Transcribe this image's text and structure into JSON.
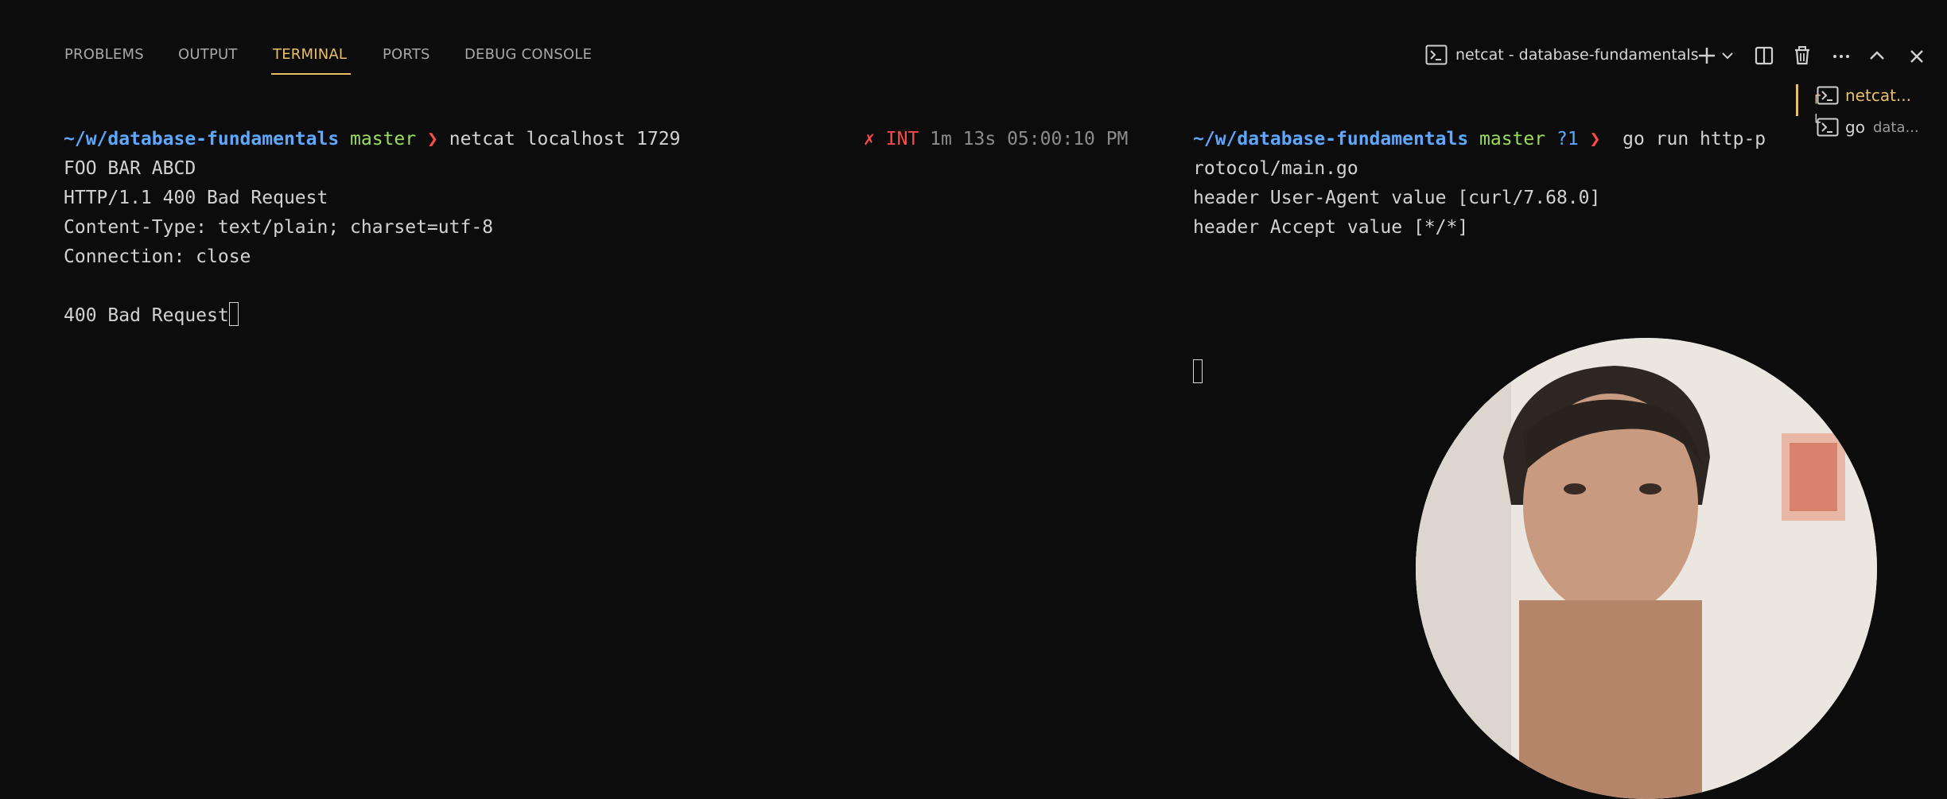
{
  "panel_tabs": [
    {
      "label": "PROBLEMS"
    },
    {
      "label": "OUTPUT"
    },
    {
      "label": "TERMINAL"
    },
    {
      "label": "PORTS"
    },
    {
      "label": "DEBUG CONSOLE"
    }
  ],
  "active_tab": "TERMINAL",
  "terminal_title": "netcat - database-fundamentals",
  "terminal_list": [
    {
      "label": "netcat...",
      "icon": "terminal-icon"
    },
    {
      "label": "go",
      "detail": "data...",
      "icon": "terminal-icon"
    }
  ],
  "left_pane": {
    "prompt": {
      "path_prefix": "~/w/",
      "path_dir": "database-fundamentals",
      "branch": "master",
      "arrow": "❯",
      "command": "netcat localhost 1729"
    },
    "status": {
      "mark": "✗",
      "signal": "INT",
      "duration": "1m 13s",
      "time": "05:00:10 PM"
    },
    "output": [
      "FOO BAR ABCD",
      "HTTP/1.1 400 Bad Request",
      "Content-Type: text/plain; charset=utf-8",
      "Connection: close",
      "",
      "400 Bad Request"
    ]
  },
  "right_pane": {
    "prompt": {
      "path_prefix": "~/w/",
      "path_dir": "database-fundamentals",
      "branch": "master",
      "status": "?1",
      "arrow": "❯",
      "command": "go run http-p"
    },
    "output": [
      "rotocol/main.go",
      "header User-Agent value [curl/7.68.0]",
      "header Accept value [*/*]"
    ]
  },
  "colors": {
    "accent": "#e8c06a",
    "path_blue": "#5ea8ff",
    "branch_green": "#9ddc5c",
    "error_red": "#ff4b4b",
    "background": "#0c0c0c"
  }
}
